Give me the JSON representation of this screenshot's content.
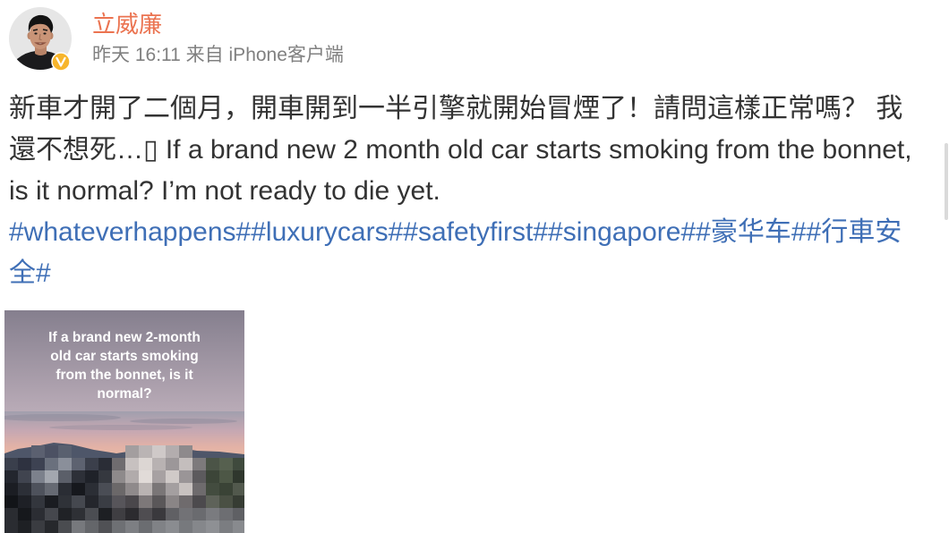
{
  "post": {
    "author": {
      "name": "立威廉",
      "avatar_icon": "user-avatar",
      "verified_icon": "verified-badge-icon"
    },
    "meta": {
      "time": "昨天 16:11",
      "source_prefix": "来自",
      "source": "iPhone客户端"
    },
    "text_lines": [
      "新車才開了二個月，開車開到一半引擎就開始冒煙了！請問這樣正常嗎？ 我",
      "還不想死…▯ If a brand new 2 month old car starts smoking from the bonnet,",
      "is it normal? I’m not ready to die yet."
    ],
    "hashtags": [
      "#whateverhappens#",
      "#luxurycars#",
      "#safetyfirst#",
      "#singapore#",
      "#豪华车#",
      "#行車安全#"
    ],
    "image": {
      "caption_lines": [
        "If a brand new 2-month",
        "old car starts smoking",
        "from the bonnet, is it",
        "normal?"
      ]
    }
  },
  "colors": {
    "username": "#eb7350",
    "text": "#333333",
    "meta": "#808080",
    "hashtag": "#3f6fb6",
    "verified_badge": "#f7b52c",
    "caption_text": "#ffffff"
  }
}
